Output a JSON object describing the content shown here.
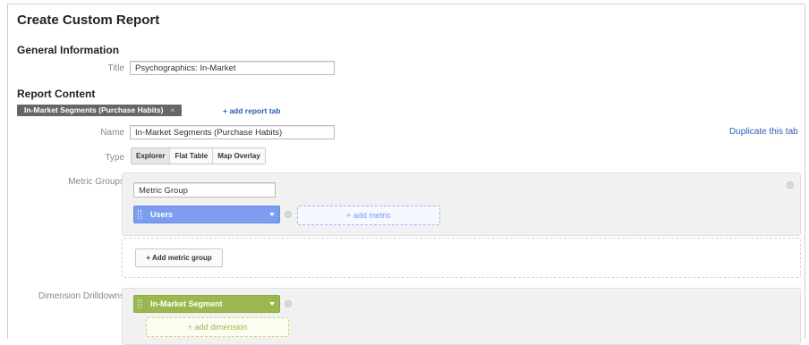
{
  "page": {
    "title": "Create Custom Report"
  },
  "general": {
    "heading": "General Information",
    "title_label": "Title",
    "title_value": "Psychographics: In-Market"
  },
  "content": {
    "heading": "Report Content",
    "tab_label": "In-Market Segments (Purchase Habits)",
    "tab_close": "×",
    "add_tab_link": "+ add report tab",
    "name_label": "Name",
    "name_value": "In-Market Segments (Purchase Habits)",
    "duplicate_link": "Duplicate this tab",
    "type_label": "Type",
    "types": [
      "Explorer",
      "Flat Table",
      "Map Overlay"
    ],
    "metric_groups_label": "Metric Groups",
    "metric_group_name": "Metric Group",
    "metric_chip": "Users",
    "add_metric": "+ add metric",
    "add_metric_group": "+ Add metric group",
    "dimension_label": "Dimension Drilldowns",
    "dimension_chip": "In-Market Segment",
    "add_dimension": "+ add dimension"
  },
  "colors": {
    "metric_blue": "#7c9df0",
    "dimension_green": "#9bb84e",
    "link_blue": "#2b5cb8",
    "tab_dark": "#666666"
  }
}
